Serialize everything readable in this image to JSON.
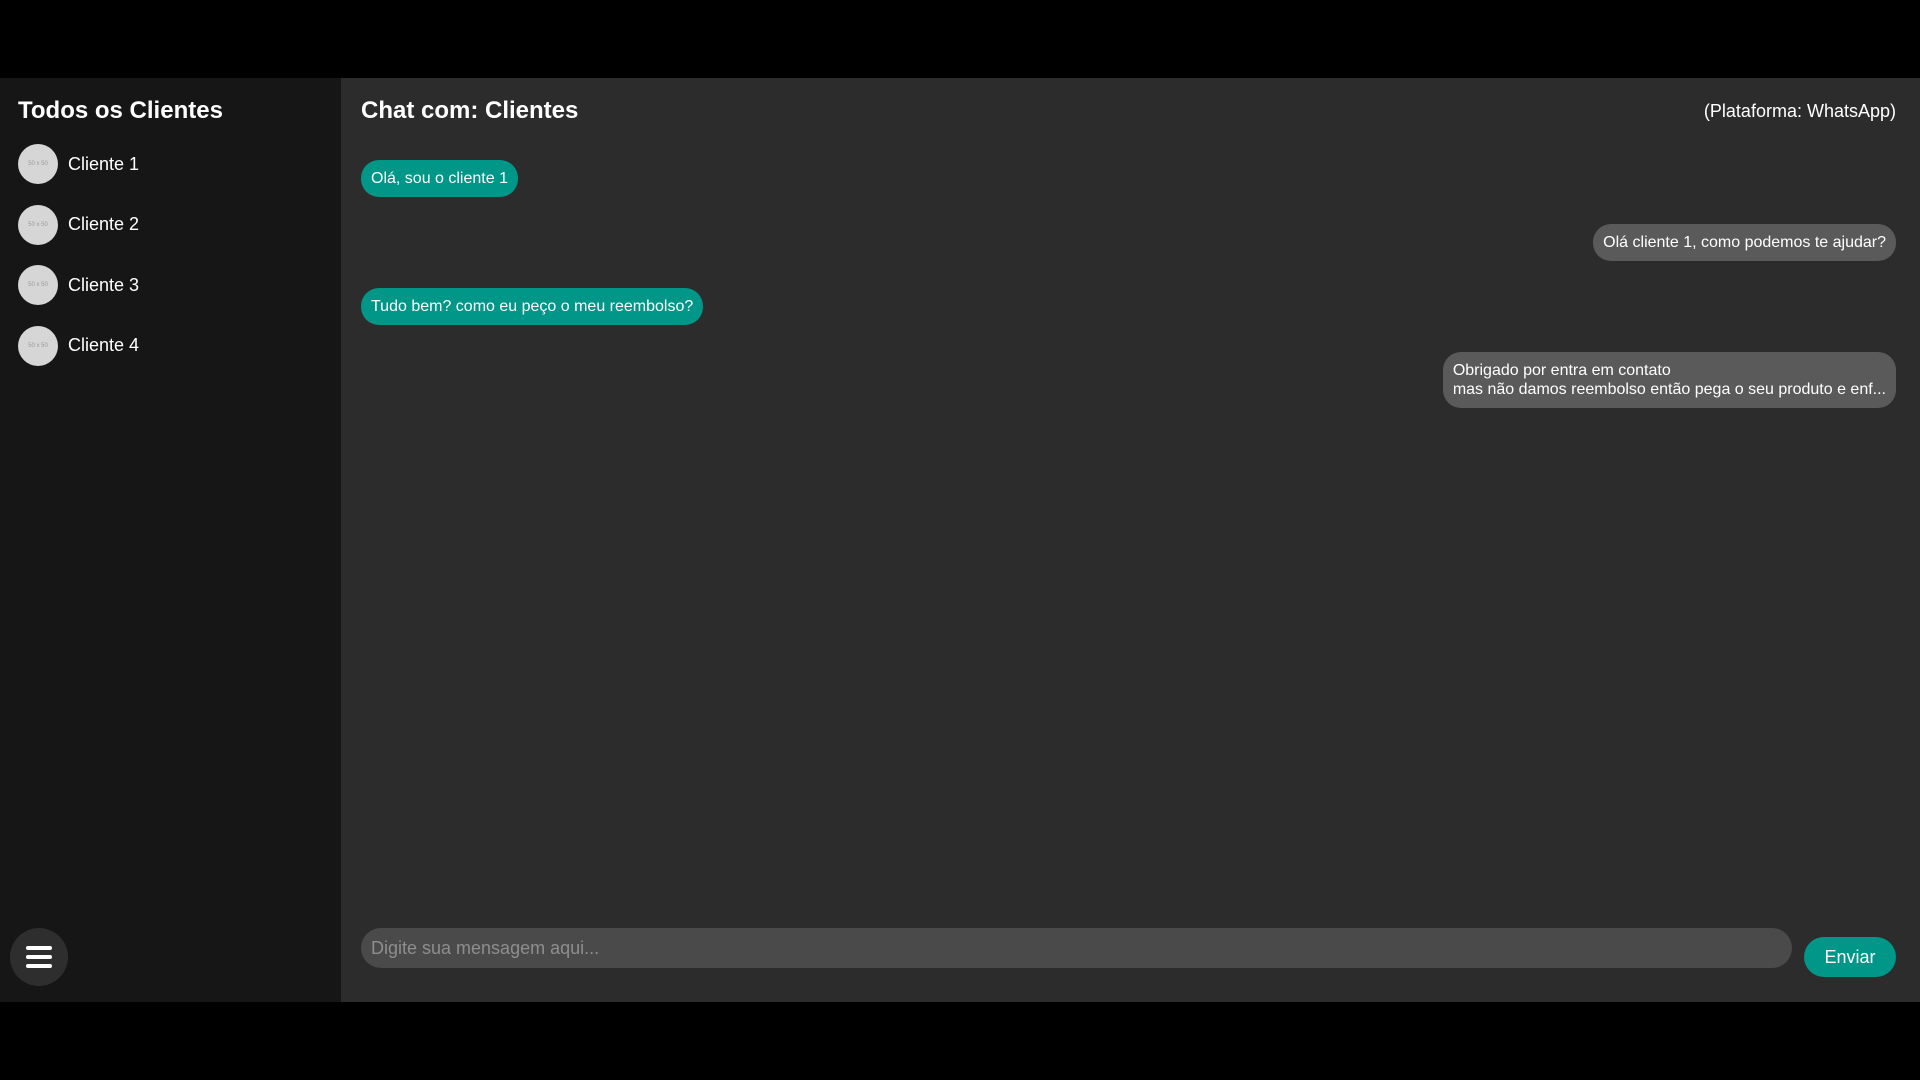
{
  "sidebar": {
    "title": "Todos os Clientes",
    "clients": [
      {
        "name": "Cliente 1",
        "avatar_text": "50 x 50"
      },
      {
        "name": "Cliente 2",
        "avatar_text": "50 x 50"
      },
      {
        "name": "Cliente 3",
        "avatar_text": "50 x 50"
      },
      {
        "name": "Cliente 4",
        "avatar_text": "50 x 50"
      }
    ],
    "menu_icon": "hamburger-menu-icon"
  },
  "chat": {
    "title": "Chat com: Clientes",
    "platform": "(Plataforma: WhatsApp)",
    "messages": [
      {
        "direction": "in",
        "text": "Olá, sou o cliente 1"
      },
      {
        "direction": "out",
        "text": "Olá cliente 1, como podemos te ajudar?"
      },
      {
        "direction": "in",
        "text": "Tudo bem? como eu peço o meu reembolso?"
      },
      {
        "direction": "out",
        "text": "Obrigado por entra em contato\nmas não damos reembolso então pega o seu produto e enf..."
      }
    ],
    "input": {
      "placeholder": "Digite sua mensagem aqui...",
      "value": ""
    },
    "send_label": "Enviar"
  },
  "colors": {
    "accent": "#009688",
    "sidebar_bg": "#161616",
    "chat_bg": "#2c2c2c",
    "outgoing_bubble": "#5a5a5a"
  }
}
